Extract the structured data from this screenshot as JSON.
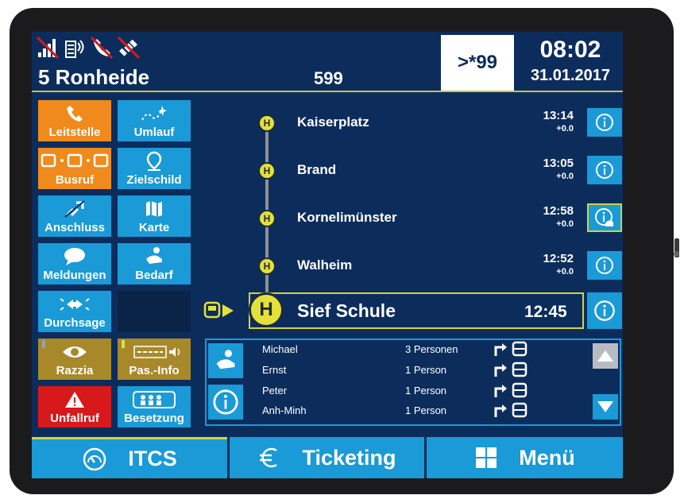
{
  "header": {
    "line_label": "5  Ronheide",
    "course": "599",
    "delay": ">*99",
    "time": "08:02",
    "date": "31.01.2017",
    "status_icons": [
      "signal-off-icon",
      "wlan-icon",
      "phone-off-icon",
      "gps-off-icon"
    ]
  },
  "tiles": [
    {
      "label": "Leitstelle",
      "icon": "phone-icon",
      "color": "#f08a1c"
    },
    {
      "label": "Umlauf",
      "icon": "route-icon",
      "color": "#1a9ad6"
    },
    {
      "label": "Busruf",
      "icon": "bus-call-icon",
      "color": "#f08a1c"
    },
    {
      "label": "Zielschild",
      "icon": "destination-pin-icon",
      "color": "#1a9ad6"
    },
    {
      "label": "Anschluss",
      "icon": "connection-icon",
      "color": "#1a9ad6"
    },
    {
      "label": "Karte",
      "icon": "map-icon",
      "color": "#1a9ad6"
    },
    {
      "label": "Meldungen",
      "icon": "message-icon",
      "color": "#1a9ad6"
    },
    {
      "label": "Bedarf",
      "icon": "wheelchair-icon",
      "color": "#1a9ad6"
    },
    {
      "label": "Durchsage",
      "icon": "announcement-icon",
      "color": "#1a9ad6"
    },
    {
      "label": "Razzia",
      "icon": "eye-icon",
      "color": "#a8892a"
    },
    {
      "label": "Pas.-Info",
      "icon": "info-speaker-icon",
      "color": "#a8892a"
    },
    {
      "label": "Unfallruf",
      "icon": "warning-icon",
      "color": "#d7191c"
    },
    {
      "label": "Besetzung",
      "icon": "occupancy-icon",
      "color": "#1a9ad6"
    }
  ],
  "stops": [
    {
      "marker": "H",
      "name": "Kaiserplatz",
      "time": "13:14",
      "delay": "+0.0"
    },
    {
      "marker": "H",
      "name": "Brand",
      "time": "13:05",
      "delay": "+0.0"
    },
    {
      "marker": "H",
      "name": "Kornelimünster",
      "time": "12:58",
      "delay": "+0.0"
    },
    {
      "marker": "H",
      "name": "Walheim",
      "time": "12:52",
      "delay": "+0.0"
    }
  ],
  "current_stop": {
    "marker": "H",
    "name": "Sief Schule",
    "time": "12:45"
  },
  "passengers": [
    {
      "name": "Michael",
      "count": "3 Personen"
    },
    {
      "name": "Ernst",
      "count": "1 Person"
    },
    {
      "name": "Peter",
      "count": "1 Person"
    },
    {
      "name": "Anh-Minh",
      "count": "1 Person"
    }
  ],
  "nav": {
    "itcs": "ITCS",
    "ticketing": "Ticketing",
    "menu": "Menü"
  },
  "colors": {
    "background": "#0c2d5c",
    "accent_blue": "#1a9ad6",
    "stop_yellow": "#e4e03a",
    "alarm_red": "#d7191c"
  }
}
